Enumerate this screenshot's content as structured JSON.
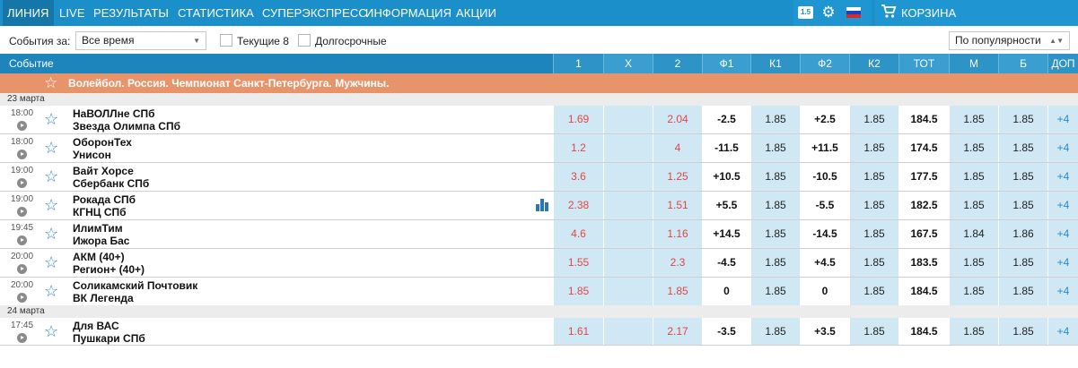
{
  "nav": {
    "items": [
      "ЛИНИЯ",
      "LIVE",
      "РЕЗУЛЬТАТЫ",
      "СТАТИСТИКА",
      "СУПЕРЭКСПРЕСС",
      "ИНФОРМАЦИЯ",
      "АКЦИИ"
    ],
    "badge": "1.5",
    "cart_label": "КОРЗИНА"
  },
  "filters": {
    "events_for_label": "События за:",
    "period_value": "Все время",
    "current_label": "Текущие 8",
    "longterm_label": "Долгосрочные",
    "sort_value": "По популярности"
  },
  "columns": [
    "Событие",
    "1",
    "X",
    "2",
    "Ф1",
    "К1",
    "Ф2",
    "К2",
    "ТОТ",
    "М",
    "Б",
    "ДОП"
  ],
  "league": "Волейбол. Россия. Чемпионат Санкт-Петербурга. Мужчины.",
  "dates": [
    "23 марта",
    "24 марта"
  ],
  "events": [
    {
      "time": "18:00",
      "team1": "НаВОЛЛне СПб",
      "team2": "Звезда Олимпа СПб",
      "o1": "1.69",
      "ox": "",
      "o2": "2.04",
      "f1": "-2.5",
      "k1": "1.85",
      "f2": "+2.5",
      "k2": "1.85",
      "tot": "184.5",
      "m": "1.85",
      "b": "1.85",
      "more": "+4"
    },
    {
      "time": "18:00",
      "team1": "ОборонТех",
      "team2": "Унисон",
      "o1": "1.2",
      "ox": "",
      "o2": "4",
      "f1": "-11.5",
      "k1": "1.85",
      "f2": "+11.5",
      "k2": "1.85",
      "tot": "174.5",
      "m": "1.85",
      "b": "1.85",
      "more": "+4"
    },
    {
      "time": "19:00",
      "team1": "Вайт Хорсе",
      "team2": "Сбербанк СПб",
      "o1": "3.6",
      "ox": "",
      "o2": "1.25",
      "f1": "+10.5",
      "k1": "1.85",
      "f2": "-10.5",
      "k2": "1.85",
      "tot": "177.5",
      "m": "1.85",
      "b": "1.85",
      "more": "+4"
    },
    {
      "time": "19:00",
      "team1": "Рокада СПб",
      "team2": "КГНЦ СПб",
      "o1": "2.38",
      "ox": "",
      "o2": "1.51",
      "f1": "+5.5",
      "k1": "1.85",
      "f2": "-5.5",
      "k2": "1.85",
      "tot": "182.5",
      "m": "1.85",
      "b": "1.85",
      "more": "+4"
    },
    {
      "time": "19:45",
      "team1": "ИлимТим",
      "team2": "Ижора Бас",
      "o1": "4.6",
      "ox": "",
      "o2": "1.16",
      "f1": "+14.5",
      "k1": "1.85",
      "f2": "-14.5",
      "k2": "1.85",
      "tot": "167.5",
      "m": "1.84",
      "b": "1.86",
      "more": "+4"
    },
    {
      "time": "20:00",
      "team1": "АКМ (40+)",
      "team2": "Регион+ (40+)",
      "o1": "1.55",
      "ox": "",
      "o2": "2.3",
      "f1": "-4.5",
      "k1": "1.85",
      "f2": "+4.5",
      "k2": "1.85",
      "tot": "183.5",
      "m": "1.85",
      "b": "1.85",
      "more": "+4"
    },
    {
      "time": "20:00",
      "team1": "Соликамский Почтовик",
      "team2": "ВК Легенда",
      "o1": "1.85",
      "ox": "",
      "o2": "1.85",
      "f1": "0",
      "k1": "1.85",
      "f2": "0",
      "k2": "1.85",
      "tot": "184.5",
      "m": "1.85",
      "b": "1.85",
      "more": "+4"
    },
    {
      "time": "17:45",
      "team1": "Для ВАС",
      "team2": "Пушкари СПб",
      "o1": "1.61",
      "ox": "",
      "o2": "2.17",
      "f1": "-3.5",
      "k1": "1.85",
      "f2": "+3.5",
      "k2": "1.85",
      "tot": "184.5",
      "m": "1.85",
      "b": "1.85",
      "more": "+4"
    }
  ],
  "icons": {
    "star": "star-icon",
    "play": "play-icon",
    "stats": "stats-icon",
    "gear": "gear-icon",
    "cart": "cart-icon",
    "flag": "russia-flag-icon"
  },
  "colors": {
    "nav": "#1a8fc9",
    "league": "#e8946a",
    "odd_highlight": "#d0e8f4",
    "odds_red": "#e04646"
  }
}
